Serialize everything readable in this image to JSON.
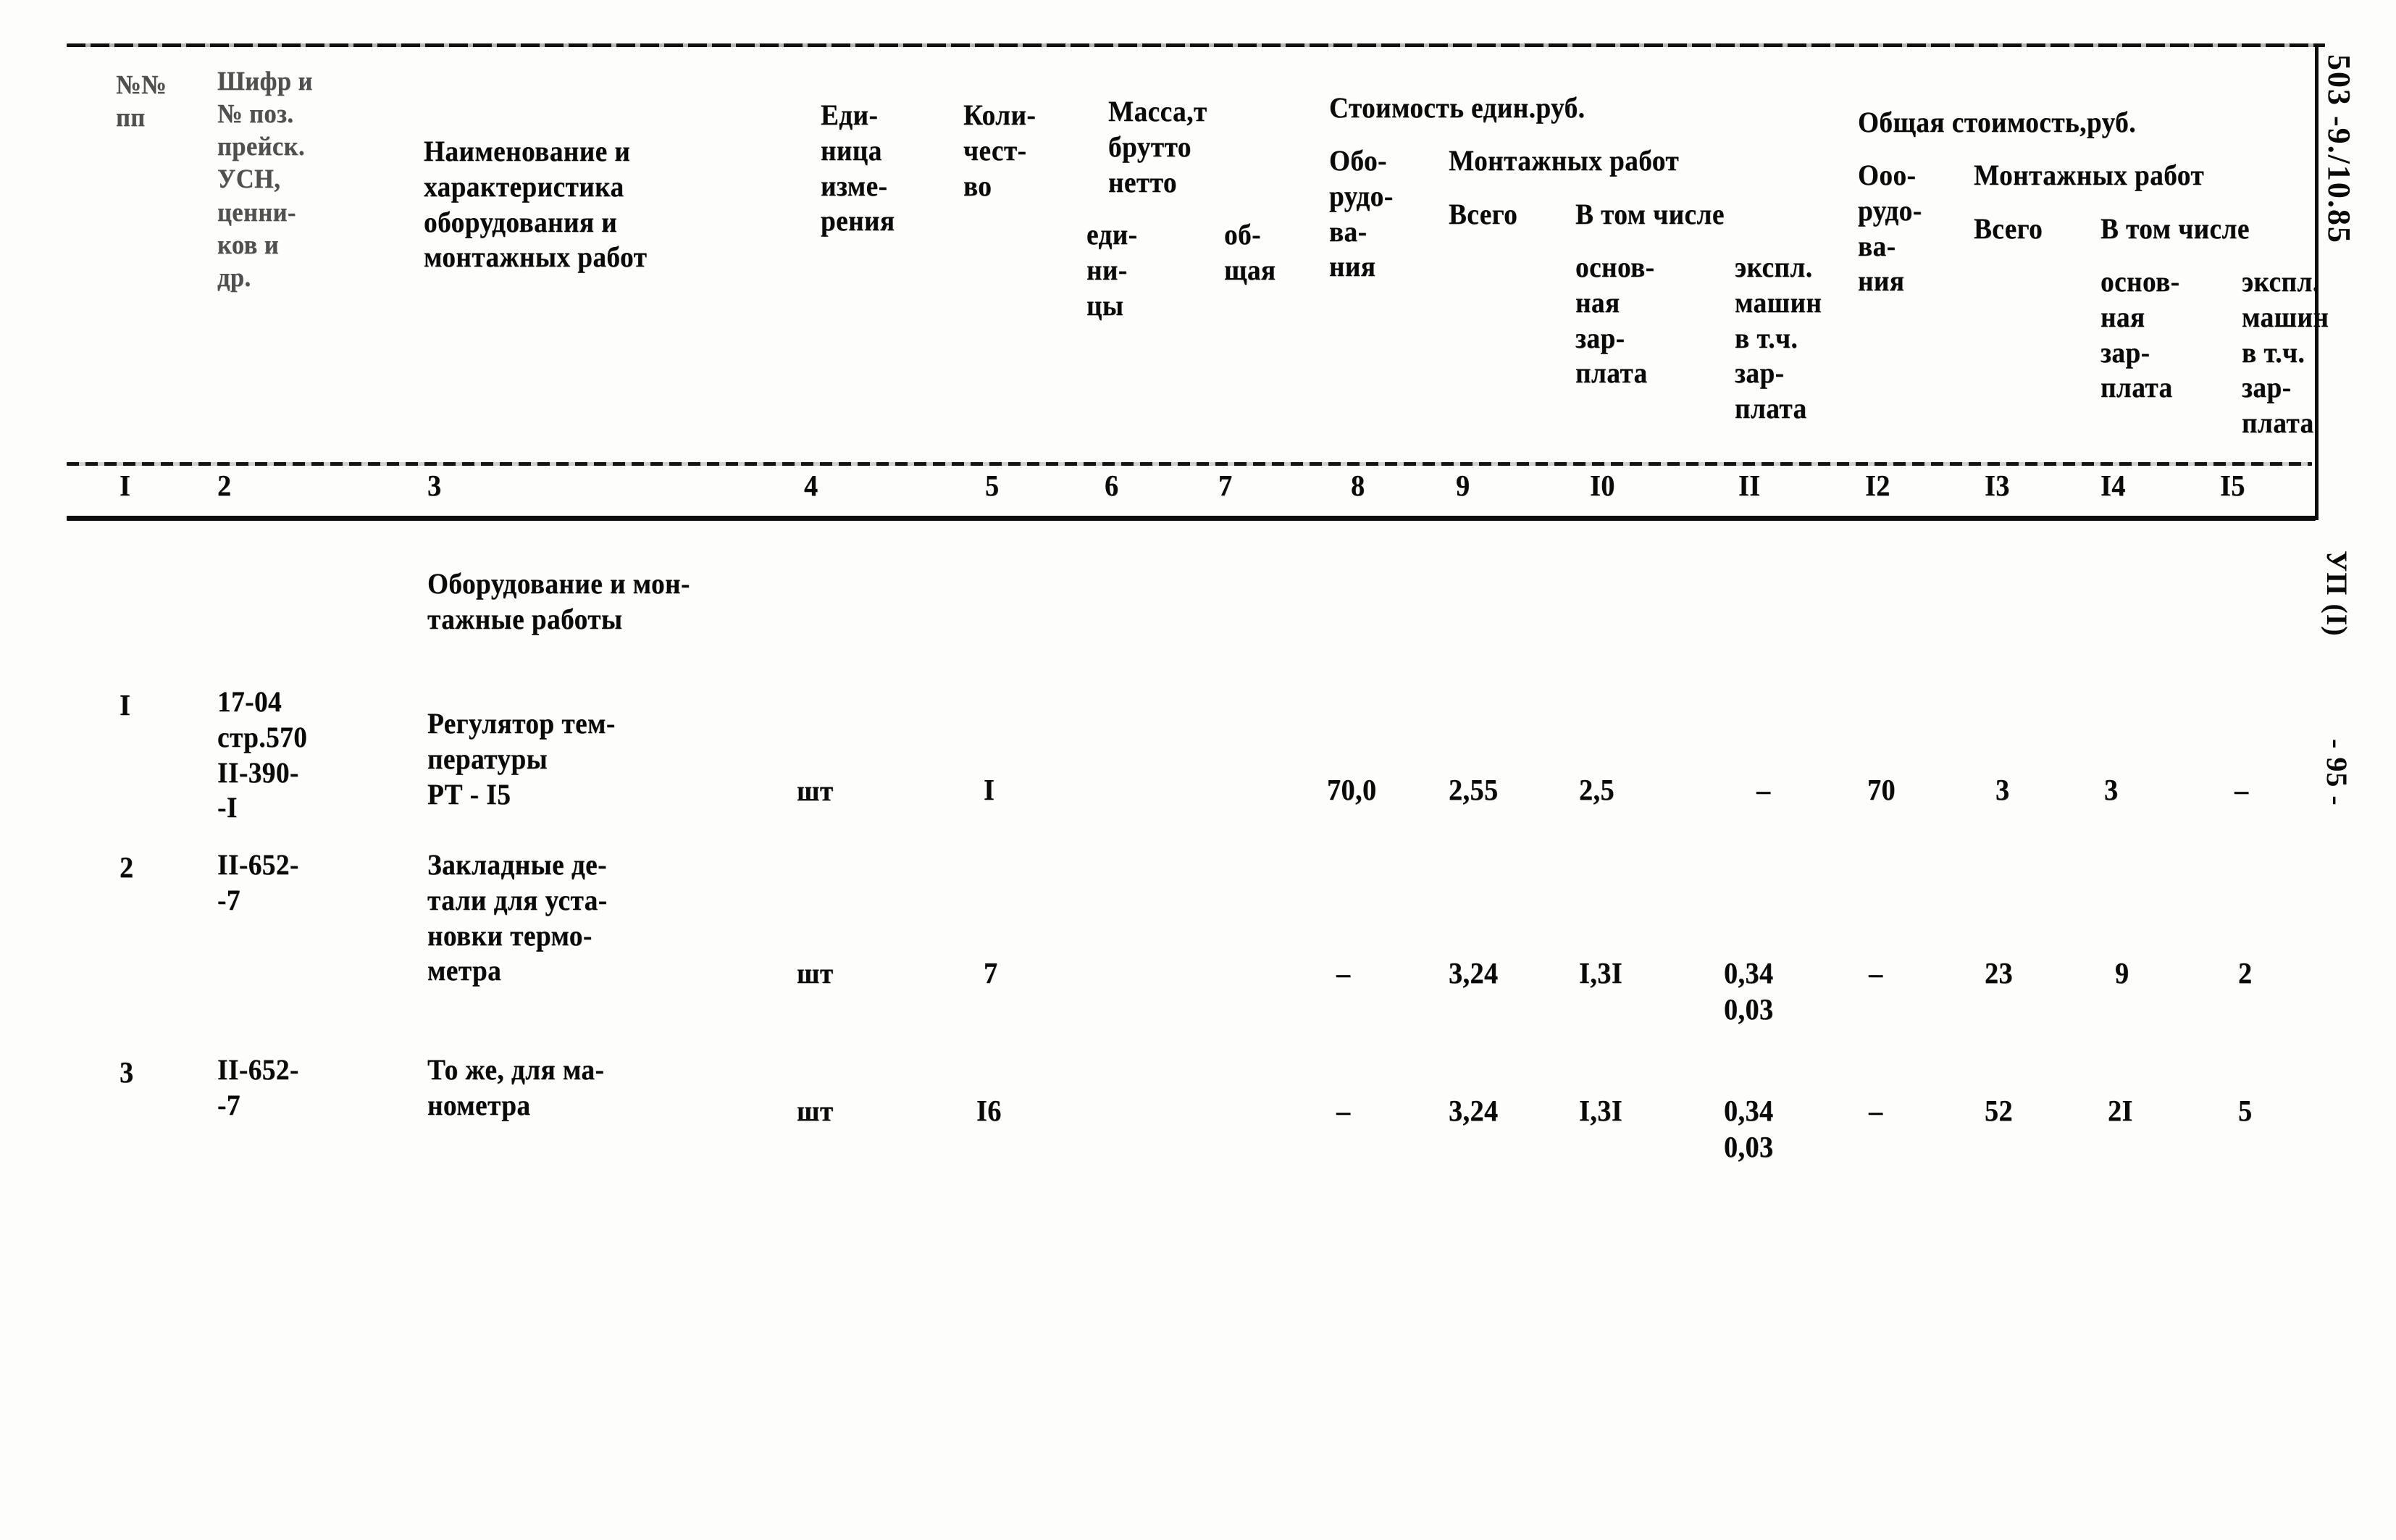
{
  "page": {
    "margin_code": "503 -9./10.85",
    "section_marker": "УП (I)",
    "page_number": "- 95 -"
  },
  "table": {
    "headers": {
      "c1": "№№\nпп",
      "c2": "Шифр и\n№ поз.\nпрейск.\nУСН,\nценни-\nков и\nдр.",
      "c3": "Наименование и\nхарактеристика\nоборудования и\nмонтажных работ",
      "c4": "Еди-\nница\nизме-\nрения",
      "c5": "Коли-\nчест-\nво",
      "mass_group": "Масса,т\nбрутто\nнетто",
      "c6": "еди-\nни-\nцы",
      "c7": "об-\nщая",
      "unit_cost_group": "Стоимость един.руб.",
      "c8": "Обо-\nрудо-\nва-\nния",
      "mount_group_1": "Монтажных работ",
      "c9": "Всего",
      "in_which_1": "В том числе",
      "c10": "основ-\nная\nзар-\nплата",
      "c11": "экспл.\nмашин\nв т.ч.\nзар-\nплата",
      "total_cost_group": "Общая стоимость,руб.",
      "c12": "Ооо-\nрудо-\nва-\nния",
      "mount_group_2": "Монтажных работ",
      "c13": "Всего",
      "in_which_2": "В том числе",
      "c14": "основ-\nная\nзар-\nплата",
      "c15": "экспл.\nмашин\nв т.ч.\nзар-\nплата"
    },
    "column_numbers": [
      "I",
      "2",
      "3",
      "4",
      "5",
      "6",
      "7",
      "8",
      "9",
      "I0",
      "II",
      "I2",
      "I3",
      "I4",
      "I5"
    ],
    "section_title": "Оборудование и мон-\nтажные работы",
    "rows": [
      {
        "no": "I",
        "code": "17-04\nстр.570\nII-390-\n-I",
        "name": "Регулятор тем-\nпературы\nРТ - I5",
        "unit": "шт",
        "qty": "I",
        "mass_unit": "",
        "mass_total": "",
        "equip_unit_cost": "70,0",
        "mount_total": "2,55",
        "mount_base_salary": "2,5",
        "mount_machines": "–",
        "equip_total_cost": "70",
        "total_mount": "3",
        "total_base_salary": "3",
        "total_machines": "–"
      },
      {
        "no": "2",
        "code": "II-652-\n-7",
        "name": "Закладные де-\nтали для уста-\nновки термо-\nметра",
        "unit": "шт",
        "qty": "7",
        "mass_unit": "",
        "mass_total": "",
        "equip_unit_cost": "–",
        "mount_total": "3,24",
        "mount_base_salary": "I,3I",
        "mount_machines": "0,34\n0,03",
        "equip_total_cost": "–",
        "total_mount": "23",
        "total_base_salary": "9",
        "total_machines": "2"
      },
      {
        "no": "3",
        "code": "II-652-\n-7",
        "name": "То же, для ма-\nнометра",
        "unit": "шт",
        "qty": "I6",
        "mass_unit": "",
        "mass_total": "",
        "equip_unit_cost": "–",
        "mount_total": "3,24",
        "mount_base_salary": "I,3I",
        "mount_machines": "0,34\n0,03",
        "equip_total_cost": "–",
        "total_mount": "52",
        "total_base_salary": "2I",
        "total_machines": "5"
      }
    ]
  }
}
